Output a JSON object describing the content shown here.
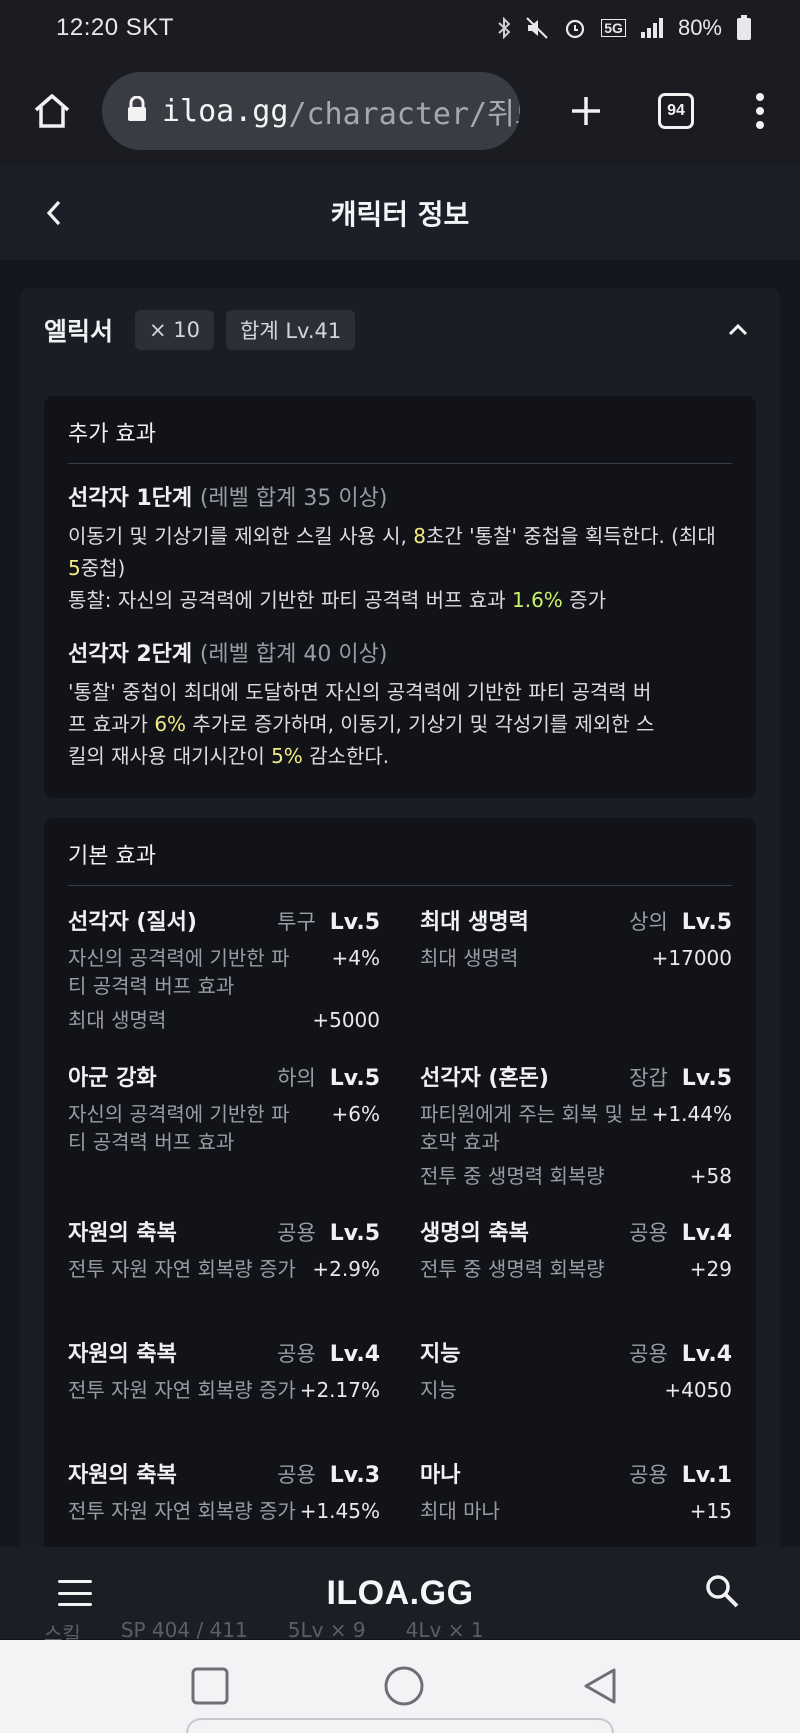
{
  "status_bar": {
    "time": "12:20",
    "carrier": "SKT",
    "network": "5G",
    "battery": "80%"
  },
  "browser": {
    "url_host": "iloa.gg",
    "url_path": "/character/쥐도",
    "tab_count": "94"
  },
  "header": {
    "title": "캐릭터 정보"
  },
  "elixir": {
    "title": "엘릭서",
    "count_chip": "× 10",
    "total_chip": "합계 Lv.41",
    "additional": {
      "title": "추가 효과",
      "tier1": {
        "name": "선각자 1단계",
        "condition": "(레벨 합계 35 이상)",
        "line1_a": "이동기 및 기상기를 제외한 스킬 사용 시, ",
        "line1_hl1": "8",
        "line1_b": "초간 '통찰' 중첩을 획득한다. (최대 ",
        "line1_hl2": "5",
        "line1_c": "중첩)",
        "line2_a": "통찰: 자신의 공격력에 기반한 파티 공격력 버프 효과 ",
        "line2_hl": "1.6%",
        "line2_b": " 증가"
      },
      "tier2": {
        "name": "선각자 2단계",
        "condition": "(레벨 합계 40 이상)",
        "desc_a": "'통찰' 중첩이 최대에 도달하면 자신의 공격력에 기반한 파티 공격력 버프 효과가 ",
        "desc_hl1": "6%",
        "desc_b": " 추가로 증가하며, 이동기, 기상기 및 각성기를 제외한 스킬의 재사용 대기시간이 ",
        "desc_hl2": "5%",
        "desc_c": " 감소한다."
      }
    },
    "base": {
      "title": "기본 효과",
      "items": [
        {
          "name": "선각자 (질서)",
          "slot": "투구",
          "level": "Lv.5",
          "stats": [
            {
              "label": "자신의 공격력에 기반한 파티 공격력 버프 효과",
              "value": "+4%"
            },
            {
              "label": "최대 생명력",
              "value": "+5000"
            }
          ]
        },
        {
          "name": "최대 생명력",
          "slot": "상의",
          "level": "Lv.5",
          "stats": [
            {
              "label": "최대 생명력",
              "value": "+17000"
            }
          ]
        },
        {
          "name": "아군 강화",
          "slot": "하의",
          "level": "Lv.5",
          "stats": [
            {
              "label": "자신의 공격력에 기반한 파티 공격력 버프 효과",
              "value": "+6%"
            }
          ]
        },
        {
          "name": "선각자 (혼돈)",
          "slot": "장갑",
          "level": "Lv.5",
          "stats": [
            {
              "label": "파티원에게 주는 회복 및 보호막 효과",
              "value": "+1.44%"
            },
            {
              "label": "전투 중 생명력 회복량",
              "value": "+58"
            }
          ]
        },
        {
          "name": "자원의 축복",
          "slot": "공용",
          "level": "Lv.5",
          "stats": [
            {
              "label": "전투 자원 자연 회복량 증가",
              "value": "+2.9%"
            }
          ]
        },
        {
          "name": "생명의 축복",
          "slot": "공용",
          "level": "Lv.4",
          "stats": [
            {
              "label": "전투 중 생명력 회복량",
              "value": "+29"
            }
          ]
        },
        {
          "name": "자원의 축복",
          "slot": "공용",
          "level": "Lv.4",
          "stats": [
            {
              "label": "전투 자원 자연 회복량 증가",
              "value": "+2.17%"
            }
          ]
        },
        {
          "name": "지능",
          "slot": "공용",
          "level": "Lv.4",
          "stats": [
            {
              "label": "지능",
              "value": "+4050"
            }
          ]
        },
        {
          "name": "자원의 축복",
          "slot": "공용",
          "level": "Lv.3",
          "stats": [
            {
              "label": "전투 자원 자연 회복량 증가",
              "value": "+1.45%"
            }
          ]
        },
        {
          "name": "마나",
          "slot": "공용",
          "level": "Lv.1",
          "stats": [
            {
              "label": "최대 마나",
              "value": "+15"
            }
          ]
        }
      ]
    }
  },
  "bottom_nav": {
    "brand": "ILOA.GG"
  },
  "peek_section": {
    "title": "스킬",
    "sp": "SP 404 / 411",
    "a": "5Lv × 9",
    "b": "4Lv × 1"
  },
  "colors": {
    "highlight_yellow": "#f3ea83",
    "highlight_green": "#c9f26d",
    "card_bg": "#1b1d24",
    "box_bg": "#111319"
  }
}
